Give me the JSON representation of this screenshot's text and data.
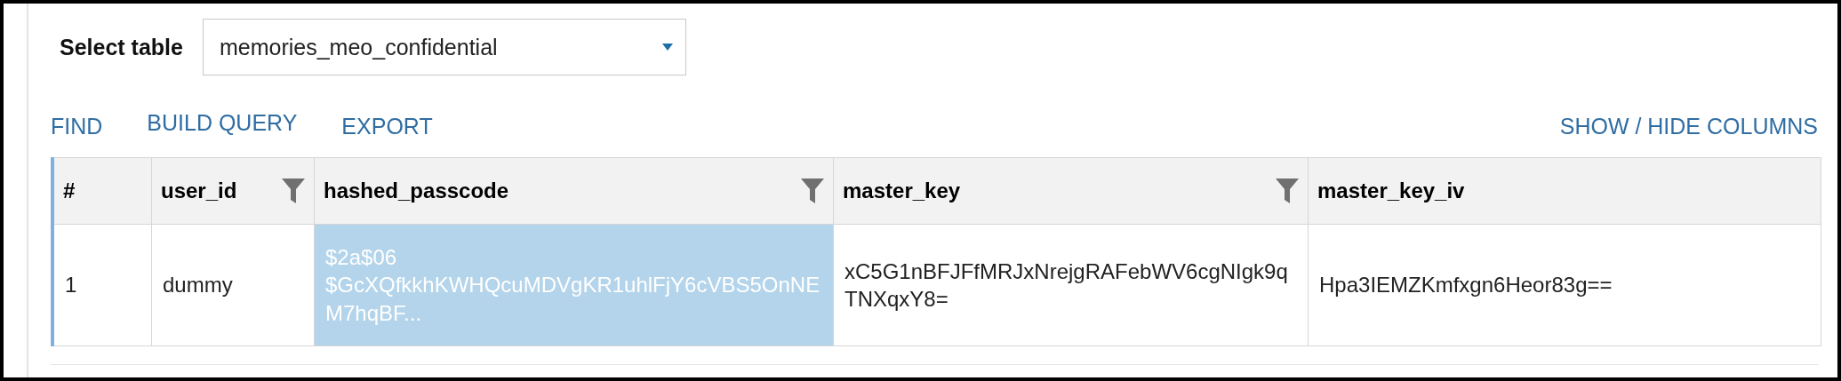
{
  "select_table": {
    "label": "Select table",
    "value": "memories_meo_confidential"
  },
  "toolbar": {
    "actions": [
      {
        "label": "FIND"
      },
      {
        "label": "BUILD QUERY"
      },
      {
        "label": "EXPORT"
      }
    ],
    "right_action": "SHOW / HIDE COLUMNS"
  },
  "table": {
    "columns": [
      {
        "label": "#",
        "filter": false
      },
      {
        "label": "user_id",
        "filter": true
      },
      {
        "label": "hashed_passcode",
        "filter": true
      },
      {
        "label": "master_key",
        "filter": true
      },
      {
        "label": "master_key_iv",
        "filter": false
      }
    ],
    "rows": [
      {
        "cells": [
          {
            "text": "1",
            "selected": false
          },
          {
            "text": "dummy",
            "selected": false
          },
          {
            "text": "$2a$06 $GcXQfkkhKWHQcuMDVgKR1uhlFjY6cVBS5OnNEM7hqBF...",
            "selected": true
          },
          {
            "text": "xC5G1nBFJFfMRJxNrejgRAFebWV6cgNIgk9qTNXqxY8=",
            "selected": false
          },
          {
            "text": "Hpa3IEMZKmfxgn6Heor83g==",
            "selected": false
          }
        ]
      }
    ]
  }
}
